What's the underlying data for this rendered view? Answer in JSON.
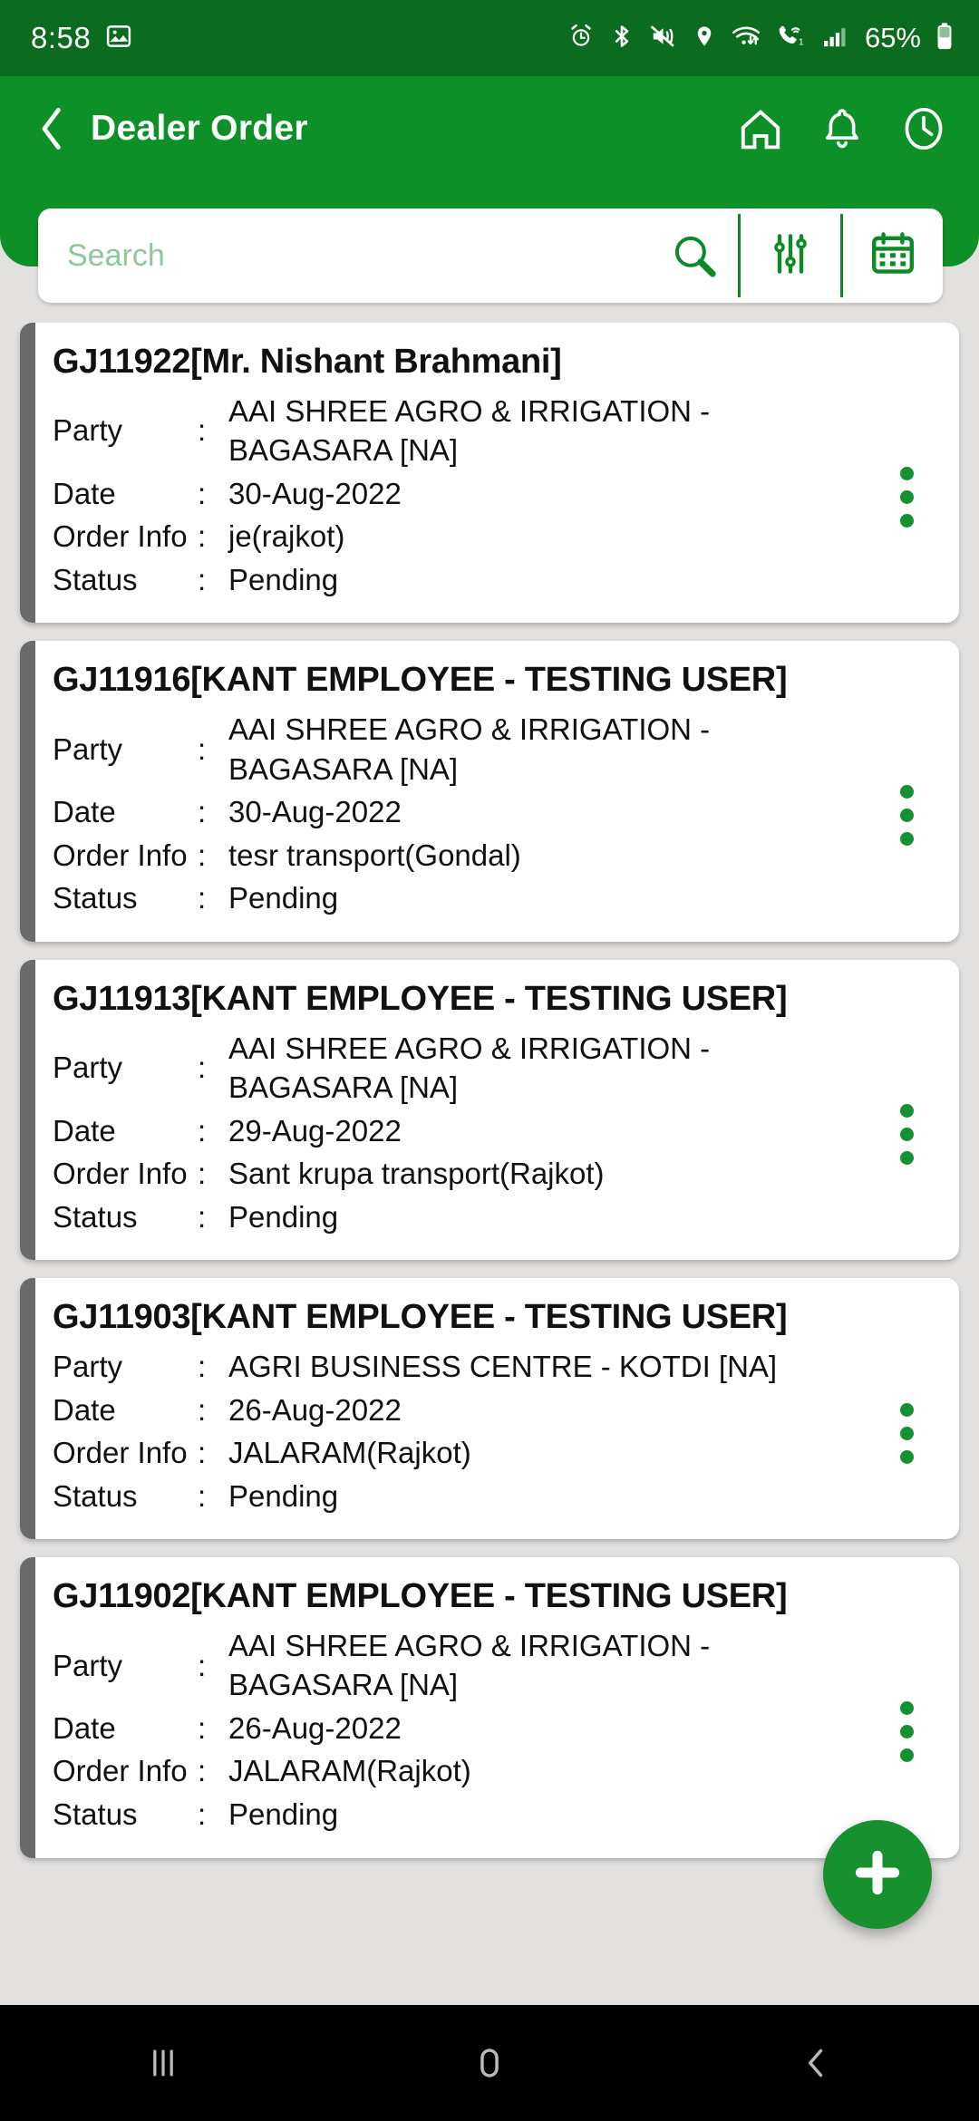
{
  "status_bar": {
    "time": "8:58",
    "battery_percent": "65%",
    "icons": [
      "gallery-icon",
      "alarm-icon",
      "bluetooth-icon",
      "mute-vibrate-icon",
      "location-icon",
      "wifi-icon",
      "wifi-calling-icon",
      "signal-bars-icon",
      "battery-icon"
    ],
    "background_color": "#0b6b1e"
  },
  "app_bar": {
    "title": "Dealer Order",
    "back_icon": "chevron-left-icon",
    "actions": [
      "home-icon",
      "bell-icon",
      "history-clock-icon"
    ],
    "background_color": "#0e9028"
  },
  "search": {
    "placeholder": "Search",
    "value": "",
    "search_icon": "magnifier-icon",
    "filter_icon": "sliders-filter-icon",
    "calendar_icon": "calendar-icon"
  },
  "labels": {
    "party": "Party",
    "date": "Date",
    "order_info": "Order Info",
    "status": "Status",
    "colon": ":"
  },
  "orders": [
    {
      "title": "GJ11922[Mr. Nishant Brahmani]",
      "party": "AAI SHREE AGRO & IRRIGATION - BAGASARA [NA]",
      "date": "30-Aug-2022",
      "order_info": "je(rajkot)",
      "status": "Pending",
      "party_wraps": true
    },
    {
      "title": "GJ11916[KANT EMPLOYEE - TESTING USER]",
      "party": "AAI SHREE AGRO & IRRIGATION - BAGASARA [NA]",
      "date": "30-Aug-2022",
      "order_info": "tesr transport(Gondal)",
      "status": "Pending",
      "party_wraps": true
    },
    {
      "title": "GJ11913[KANT EMPLOYEE - TESTING USER]",
      "party": "AAI SHREE AGRO & IRRIGATION - BAGASARA [NA]",
      "date": "29-Aug-2022",
      "order_info": "Sant krupa transport(Rajkot)",
      "status": "Pending",
      "party_wraps": true
    },
    {
      "title": "GJ11903[KANT EMPLOYEE - TESTING USER]",
      "party": "AGRI BUSINESS CENTRE -  KOTDI [NA]",
      "date": "26-Aug-2022",
      "order_info": "JALARAM(Rajkot)",
      "status": "Pending",
      "party_wraps": false
    },
    {
      "title": "GJ11902[KANT EMPLOYEE - TESTING USER]",
      "party": "AAI SHREE AGRO & IRRIGATION - BAGASARA [NA]",
      "date": "26-Aug-2022",
      "order_info": "JALARAM(Rajkot)",
      "status": "Pending",
      "party_wraps": true
    }
  ],
  "fab": {
    "icon": "plus-icon",
    "color": "#179130"
  },
  "nav_bar": {
    "recents_icon": "recents-icon",
    "home_icon": "home-square-icon",
    "back_icon": "back-chevron-icon",
    "background_color": "#000000"
  },
  "theme": {
    "primary": "#0e9028",
    "primary_dark": "#0b6b1e",
    "accent_dot": "#149133",
    "page_background": "#e3e1df"
  }
}
